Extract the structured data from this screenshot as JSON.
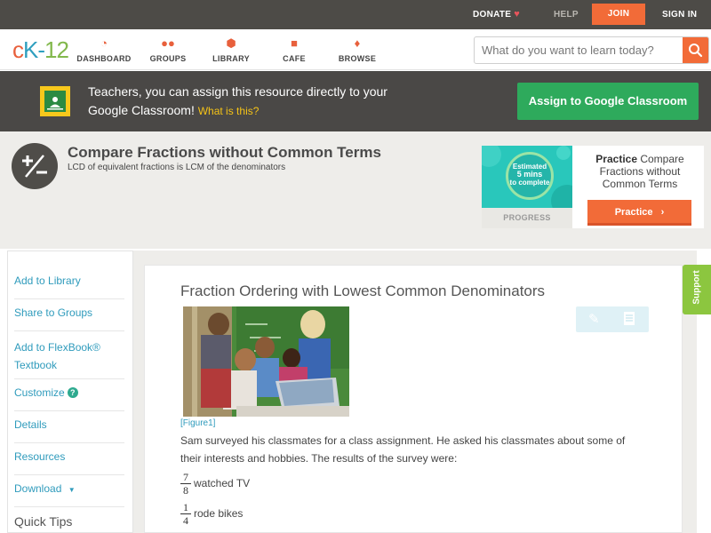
{
  "topbar": {
    "donate": "DONATE",
    "help": "HELP",
    "join": "JOIN",
    "sign_in": "SIGN IN"
  },
  "header": {
    "logo": {
      "c": "c",
      "k": "K",
      "dash": "-",
      "num": "12"
    },
    "nav": [
      {
        "label": "DASHBOARD",
        "icon": "dashboard-icon"
      },
      {
        "label": "GROUPS",
        "icon": "groups-icon"
      },
      {
        "label": "LIBRARY",
        "icon": "library-icon"
      },
      {
        "label": "CAFE",
        "icon": "cafe-icon"
      },
      {
        "label": "BROWSE",
        "icon": "browse-icon"
      }
    ],
    "search_placeholder": "What do you want to learn today?"
  },
  "banner": {
    "text": "Teachers, you can assign this resource directly to your Google Classroom!",
    "link": "What is this?",
    "button": "Assign to Google Classroom"
  },
  "concept": {
    "title": "Compare Fractions without Common Terms",
    "subtitle": "LCD of equivalent fractions is LCM of the denominators",
    "progress": {
      "line1": "Estimated",
      "line2": "5 mins",
      "line3": "to complete",
      "label": "PROGRESS"
    },
    "practice": {
      "bold": "Practice",
      "rest": "Compare Fractions without Common Terms",
      "button": "Practice"
    }
  },
  "sidebar": {
    "items": [
      {
        "label": "Add to Library"
      },
      {
        "label": "Share to Groups"
      },
      {
        "label": "Add to FlexBook® Textbook"
      },
      {
        "label": "Customize"
      },
      {
        "label": "Details"
      },
      {
        "label": "Resources"
      },
      {
        "label": "Download"
      }
    ],
    "help_badge": "?",
    "quick_tips": "Quick Tips"
  },
  "lesson": {
    "title": "Fraction Ordering with Lowest Common Denominators",
    "figure": "[Figure1]",
    "paragraph": "Sam surveyed his classmates for a class assignment. He asked his classmates about some of their interests and hobbies. The results of the survey were:",
    "fractions": [
      {
        "num": "7",
        "den": "8",
        "text": "watched TV"
      },
      {
        "num": "1",
        "den": "4",
        "text": "rode bikes"
      }
    ]
  },
  "support": "Support",
  "colors": {
    "accent_orange": "#f26b38",
    "link_blue": "#2f9bbc",
    "green_button": "#2eaa5c",
    "support_green": "#8cc63f"
  }
}
